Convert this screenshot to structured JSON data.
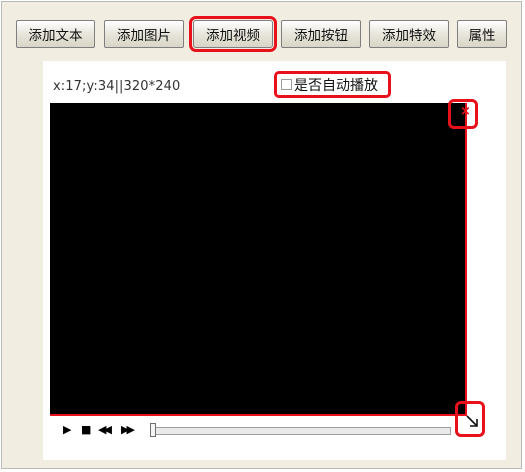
{
  "toolbar": {
    "buttons": [
      {
        "label": "添加文本"
      },
      {
        "label": "添加图片"
      },
      {
        "label": "添加视频"
      },
      {
        "label": "添加按钮"
      },
      {
        "label": "添加特效"
      },
      {
        "label": "属性"
      }
    ],
    "highlighted": "添加视频"
  },
  "panel": {
    "coordinates": "x:17;y:34||320*240",
    "autoplay": {
      "label": "是否自动播放",
      "checked": false
    },
    "close_glyph": "×",
    "controls": {
      "play_glyph": "▶",
      "stop_glyph": "■",
      "rewind_glyph": "◀◀",
      "forward_glyph": "▶▶",
      "progress": 0
    }
  },
  "colors": {
    "highlight": "#e8101a",
    "video_background": "#000000",
    "frame_background": "#f1ede0"
  },
  "icons": [
    "play-icon",
    "stop-icon",
    "rewind-icon",
    "fast-forward-icon",
    "close-icon",
    "resize-icon"
  ]
}
